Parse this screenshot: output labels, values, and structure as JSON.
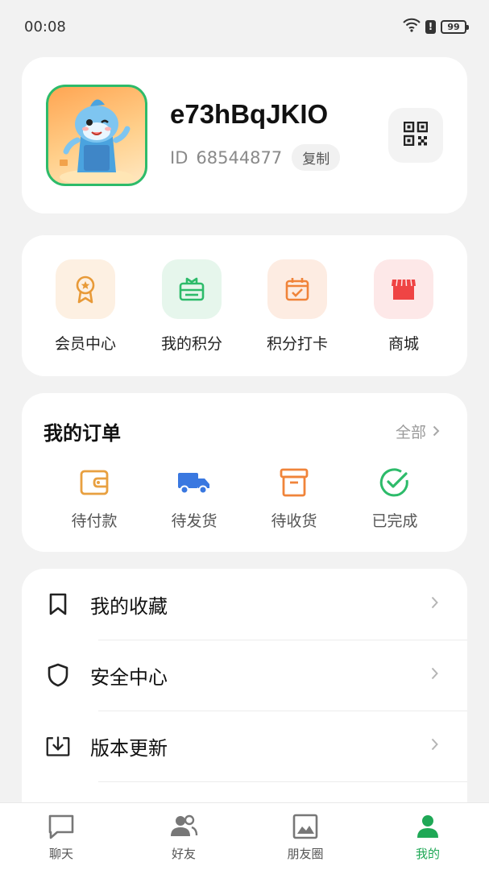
{
  "status_bar": {
    "time": "00:08",
    "battery": "99"
  },
  "profile": {
    "username": "e73hBqJKIO",
    "id_label": "ID",
    "id_value": "68544877",
    "copy_label": "复制"
  },
  "quick_actions": [
    {
      "label": "会员中心",
      "icon": "medal-icon",
      "bg": "#fdf0e2",
      "color": "#e89a38"
    },
    {
      "label": "我的积分",
      "icon": "gift-card-icon",
      "bg": "#e6f6ec",
      "color": "#2dbb6a"
    },
    {
      "label": "积分打卡",
      "icon": "calendar-check-icon",
      "bg": "#fdece2",
      "color": "#f0843a"
    },
    {
      "label": "商城",
      "icon": "store-icon",
      "bg": "#fde8e8",
      "color": "#ef4444"
    }
  ],
  "orders": {
    "title": "我的订单",
    "all_label": "全部",
    "items": [
      {
        "label": "待付款",
        "icon": "wallet-icon",
        "color": "#e8a040"
      },
      {
        "label": "待发货",
        "icon": "truck-icon",
        "color": "#3a78e0"
      },
      {
        "label": "待收货",
        "icon": "package-box-icon",
        "color": "#f0843a"
      },
      {
        "label": "已完成",
        "icon": "check-circle-icon",
        "color": "#2dbb6a"
      }
    ]
  },
  "menu": [
    {
      "label": "我的收藏",
      "icon": "bookmark-icon"
    },
    {
      "label": "安全中心",
      "icon": "shield-icon"
    },
    {
      "label": "版本更新",
      "icon": "download-icon"
    }
  ],
  "tabbar": [
    {
      "label": "聊天",
      "icon": "chat-icon",
      "active": false
    },
    {
      "label": "好友",
      "icon": "friends-icon",
      "active": false
    },
    {
      "label": "朋友圈",
      "icon": "image-icon",
      "active": false
    },
    {
      "label": "我的",
      "icon": "person-icon",
      "active": true
    }
  ],
  "colors": {
    "accent": "#1fa856",
    "background": "#f2f2f2"
  }
}
